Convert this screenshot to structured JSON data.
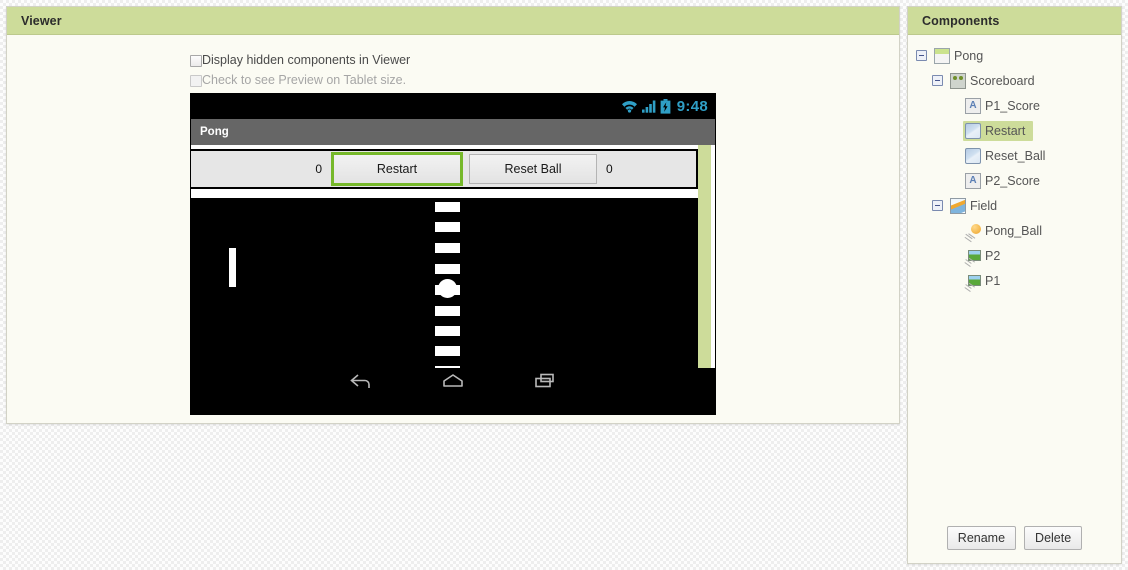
{
  "viewer": {
    "header_title": "Viewer",
    "checkbox_hidden_label": "Display hidden components in Viewer",
    "checkbox_tablet_label": "Check to see Preview on Tablet size."
  },
  "phone": {
    "status_bar": {
      "wifi_icon": "wifi-icon",
      "signal_icon": "signal-bars-icon",
      "battery_icon": "battery-icon",
      "clock": "9:48",
      "accent_color": "#2f9fc6"
    },
    "title_bar_text": "Pong",
    "scoreboard": {
      "p1_score": "0",
      "restart_label": "Restart",
      "reset_ball_label": "Reset Ball",
      "p2_score": "0",
      "selection_color": "#76b82a"
    },
    "field": {
      "background_color": "#000000",
      "center_line_color": "#ffffff",
      "dash_count": 9,
      "paddle_color": "#ffffff",
      "ball_color": "#ffffff"
    },
    "nav_bar": {
      "back_icon": "back-arrow-icon",
      "home_icon": "home-icon",
      "recents_icon": "recent-apps-icon"
    }
  },
  "components": {
    "header_title": "Components",
    "tree": [
      {
        "label": "Pong",
        "icon": "screen-icon",
        "level": 1,
        "expander": "collapse",
        "selected": false
      },
      {
        "label": "Scoreboard",
        "icon": "horizontal-arrangement-icon",
        "level": 2,
        "expander": "collapse",
        "selected": false
      },
      {
        "label": "P1_Score",
        "icon": "label-icon",
        "level": 3,
        "expander": "none",
        "selected": false
      },
      {
        "label": "Restart",
        "icon": "button-icon",
        "level": 3,
        "expander": "none",
        "selected": true
      },
      {
        "label": "Reset_Ball",
        "icon": "button-icon",
        "level": 3,
        "expander": "none",
        "selected": false
      },
      {
        "label": "P2_Score",
        "icon": "label-icon",
        "level": 3,
        "expander": "none",
        "selected": false
      },
      {
        "label": "Field",
        "icon": "canvas-icon",
        "level": 2,
        "expander": "collapse",
        "selected": false
      },
      {
        "label": "Pong_Ball",
        "icon": "ball-icon",
        "level": 3,
        "expander": "none",
        "selected": false
      },
      {
        "label": "P2",
        "icon": "image-sprite-icon",
        "level": 3,
        "expander": "none",
        "selected": false
      },
      {
        "label": "P1",
        "icon": "image-sprite-icon",
        "level": 3,
        "expander": "none",
        "selected": false
      }
    ],
    "label_icon_letter": "A",
    "rename_label": "Rename",
    "delete_label": "Delete"
  },
  "theme": {
    "header_green": "#cddc9a",
    "panel_bg": "#fbfbf3",
    "selection_green": "#cddc9a"
  }
}
